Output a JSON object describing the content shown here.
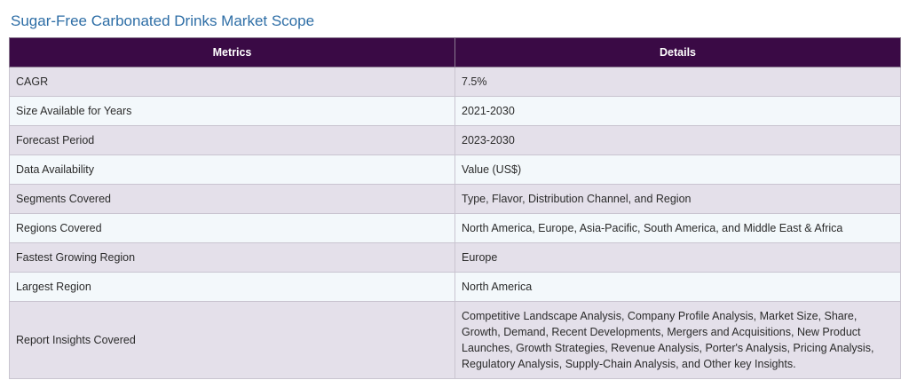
{
  "title": "Sugar-Free Carbonated Drinks Market Scope",
  "table": {
    "headers": [
      "Metrics",
      "Details"
    ],
    "rows": [
      {
        "metric": "CAGR",
        "detail": "7.5%"
      },
      {
        "metric": "Size Available for Years",
        "detail": "2021-2030"
      },
      {
        "metric": "Forecast Period",
        "detail": "2023-2030"
      },
      {
        "metric": "Data Availability",
        "detail": "Value (US$)"
      },
      {
        "metric": "Segments Covered",
        "detail": "Type, Flavor, Distribution Channel, and Region"
      },
      {
        "metric": "Regions Covered",
        "detail": "North America, Europe, Asia-Pacific, South America, and Middle East & Africa"
      },
      {
        "metric": "Fastest Growing Region",
        "detail": "Europe"
      },
      {
        "metric": "Largest Region",
        "detail": "North America"
      },
      {
        "metric": "Report Insights Covered",
        "detail": "Competitive Landscape Analysis, Company Profile Analysis, Market Size, Share, Growth, Demand, Recent Developments, Mergers and Acquisitions, New Product Launches, Growth Strategies, Revenue Analysis, Porter's Analysis, Pricing Analysis, Regulatory Analysis, Supply-Chain Analysis, and Other key Insights."
      }
    ]
  },
  "colors": {
    "title": "#2e6ea6",
    "header_bg": "#3a0a45",
    "row_alt_1": "#e4e0ea",
    "row_alt_2": "#f3f8fb"
  }
}
